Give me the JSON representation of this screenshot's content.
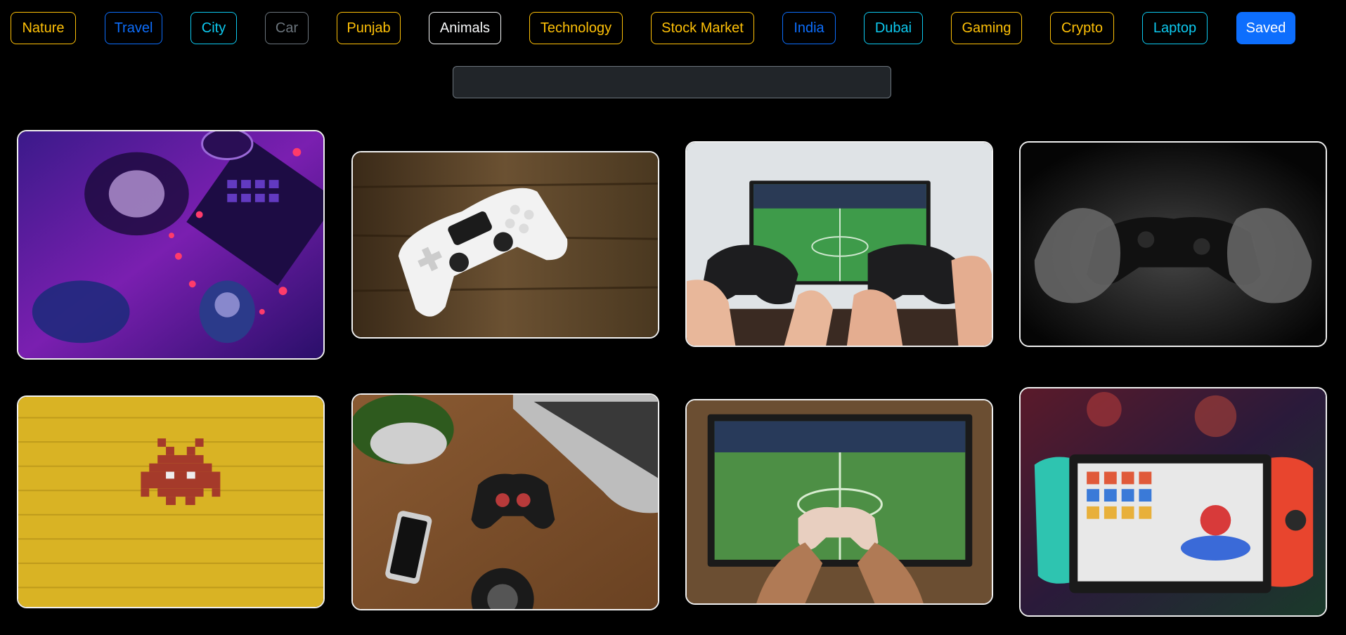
{
  "categories": [
    {
      "label": "Nature",
      "style": "warning"
    },
    {
      "label": "Travel",
      "style": "primary"
    },
    {
      "label": "City",
      "style": "info"
    },
    {
      "label": "Car",
      "style": "secondary"
    },
    {
      "label": "Punjab",
      "style": "warning"
    },
    {
      "label": "Animals",
      "style": "light"
    },
    {
      "label": "Technology",
      "style": "warning"
    },
    {
      "label": "Stock Market",
      "style": "warning"
    },
    {
      "label": "India",
      "style": "primary"
    },
    {
      "label": "Dubai",
      "style": "info"
    },
    {
      "label": "Gaming",
      "style": "warning"
    },
    {
      "label": "Crypto",
      "style": "warning"
    },
    {
      "label": "Laptop",
      "style": "info"
    },
    {
      "label": "Saved",
      "style": "solid-primary"
    }
  ],
  "search": {
    "value": "",
    "placeholder": ""
  },
  "colors": {
    "warning": "#ffc107",
    "primary": "#0d6efd",
    "info": "#0dcaf0",
    "secondary": "#6c757d",
    "light": "#f8f9fa",
    "background": "#000000",
    "input_bg": "#212529"
  },
  "gallery": [
    {
      "subject": "neon gaming desk with headset, keyboard and controller"
    },
    {
      "subject": "white game controller on wooden table"
    },
    {
      "subject": "two hands holding controllers in front of football game on TV"
    },
    {
      "subject": "black and white hands holding controller"
    },
    {
      "subject": "pixel space invader on yellow brick wall"
    },
    {
      "subject": "desk top view with controller, phone, laptop and headphones"
    },
    {
      "subject": "hands holding controller in front of football game on TV"
    },
    {
      "subject": "handheld console showing kart racing game"
    }
  ]
}
